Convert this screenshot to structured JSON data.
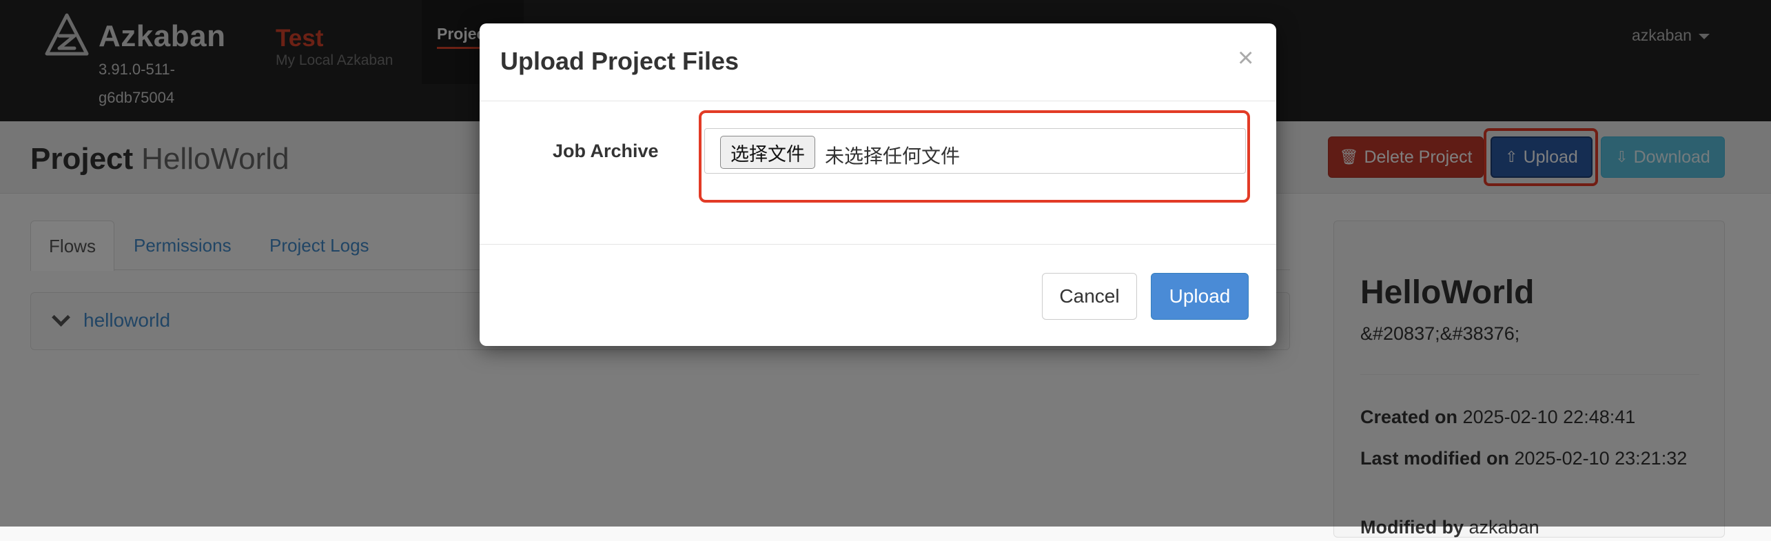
{
  "navbar": {
    "brand": "Azkaban",
    "version": "3.91.0-511-g6db75004",
    "env_name": "Test",
    "env_subtitle": "My Local Azkaban",
    "active_tab": "Projects",
    "user": "azkaban"
  },
  "project": {
    "label": "Project",
    "name": "HelloWorld",
    "buttons": {
      "delete": "Delete Project",
      "upload": "Upload",
      "download": "Download"
    }
  },
  "tabs": [
    "Flows",
    "Permissions",
    "Project Logs"
  ],
  "flows": [
    {
      "name": "helloworld"
    }
  ],
  "info": {
    "name": "HelloWorld",
    "description": "&#20837;&#38376;",
    "created_label": "Created on",
    "created_value": "2025-02-10 22:48:41",
    "modified_label": "Last modified on",
    "modified_value": "2025-02-10 23:21:32",
    "modified_by_label": "Modified by",
    "modified_by_value": "azkaban"
  },
  "modal": {
    "title": "Upload Project Files",
    "close": "×",
    "field_label": "Job Archive",
    "choose_file": "选择文件",
    "no_file": "未选择任何文件",
    "cancel": "Cancel",
    "upload": "Upload"
  },
  "colors": {
    "navbar_bg": "#222222",
    "accent_red": "#d9432a",
    "primary_blue": "#2b5aa4",
    "highlight_box": "#e23b26"
  }
}
